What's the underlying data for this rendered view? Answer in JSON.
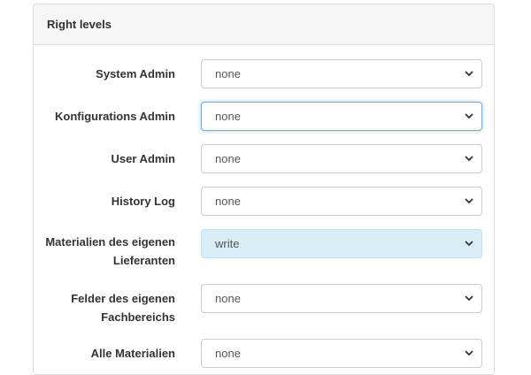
{
  "panel": {
    "title": "Right levels"
  },
  "fields": [
    {
      "label": "System Admin",
      "value": "none"
    },
    {
      "label": "Konfigurations Admin",
      "value": "none"
    },
    {
      "label": "User Admin",
      "value": "none"
    },
    {
      "label": "History Log",
      "value": "none"
    },
    {
      "label": "Materialien des eigenen Lieferanten",
      "value": "write"
    },
    {
      "label": "Felder des eigenen Fachbereichs",
      "value": "none"
    },
    {
      "label": "Alle Materialien",
      "value": "none"
    }
  ],
  "icons": {
    "select_arrow": "chevron-down-icon"
  },
  "colors": {
    "focus_border": "#66afe9",
    "highlight_background": "#d9edf7"
  }
}
